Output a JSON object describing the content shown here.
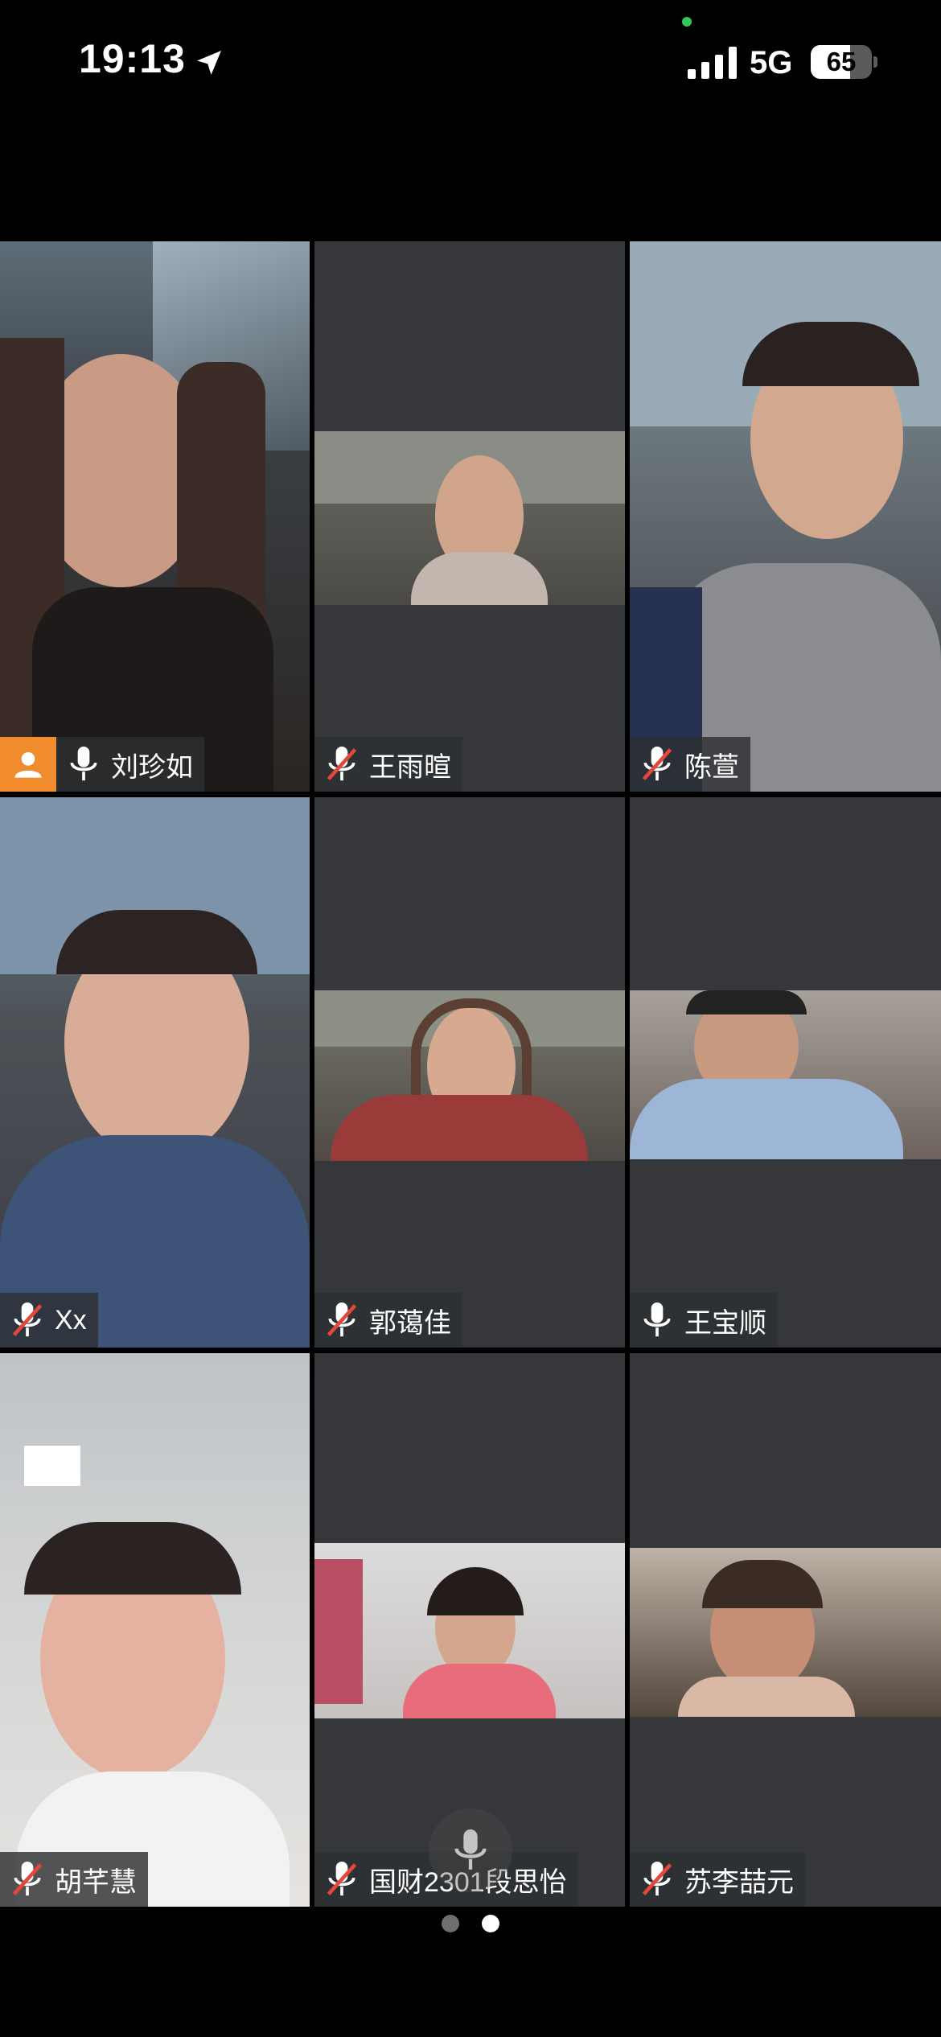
{
  "status_bar": {
    "time": "19:13",
    "network": "5G",
    "battery_percent": "65",
    "battery_level": 0.65,
    "location_icon": "location-arrow-icon",
    "signal_icon": "cellular-signal-icon"
  },
  "participants": [
    {
      "name": "刘珍如",
      "mic": "on",
      "host": true
    },
    {
      "name": "王雨暄",
      "mic": "muted",
      "host": false
    },
    {
      "name": "陈萱",
      "mic": "muted",
      "host": false
    },
    {
      "name": "Xx",
      "mic": "muted",
      "host": false
    },
    {
      "name": "郭蔼佳",
      "mic": "muted",
      "host": false
    },
    {
      "name": "王宝顺",
      "mic": "on",
      "host": false
    },
    {
      "name": "胡芊慧",
      "mic": "muted",
      "host": false
    },
    {
      "name": "国财2301段思怡",
      "mic": "muted",
      "host": false
    },
    {
      "name": "苏李喆元",
      "mic": "muted",
      "host": false
    }
  ],
  "pagination": {
    "pages": 2,
    "current": 2
  },
  "colors": {
    "tile_bg": "#35373a",
    "host_badge": "#f08c2e",
    "muted_slash": "#e5473b"
  }
}
